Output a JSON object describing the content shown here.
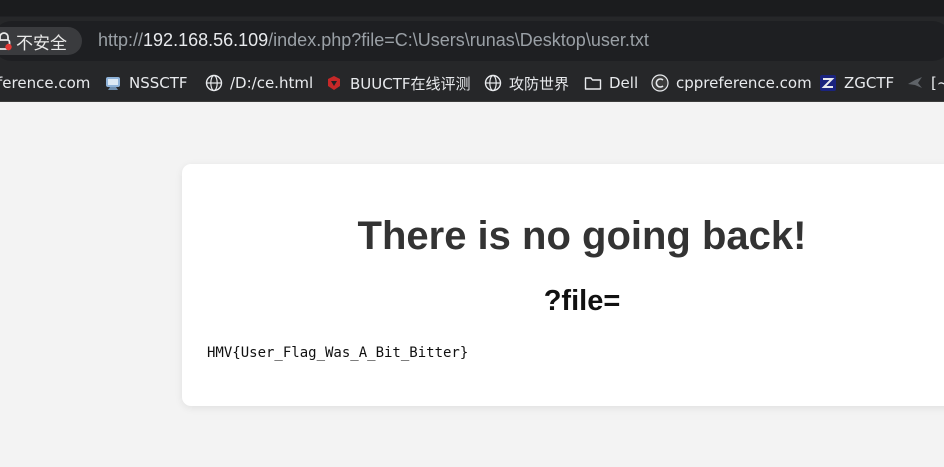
{
  "browser": {
    "security_label": "不安全",
    "url_prefix": "http://",
    "url_host": "192.168.56.109",
    "url_path": "/index.php?file=C:\\Users\\runas\\Desktop\\user.txt"
  },
  "bookmarks": [
    {
      "label": "ference.com",
      "icon": "partial-bookmark-icon"
    },
    {
      "label": "NSSCTF",
      "icon": "nssctf-icon"
    },
    {
      "label": "/D:/ce.html",
      "icon": "globe-icon"
    },
    {
      "label": "BUUCTF在线评测",
      "icon": "buuctf-icon"
    },
    {
      "label": "攻防世界",
      "icon": "globe-icon"
    },
    {
      "label": "Dell",
      "icon": "folder-icon"
    },
    {
      "label": "cppreference.com",
      "icon": "cppreference-icon"
    },
    {
      "label": "ZGCTF",
      "icon": "zgctf-icon"
    },
    {
      "label": "[~",
      "icon": "bird-icon"
    }
  ],
  "page": {
    "heading": "There is no going back!",
    "subheading": "?file=",
    "file_content": "HMV{User_Flag_Was_A_Bit_Bitter}"
  }
}
